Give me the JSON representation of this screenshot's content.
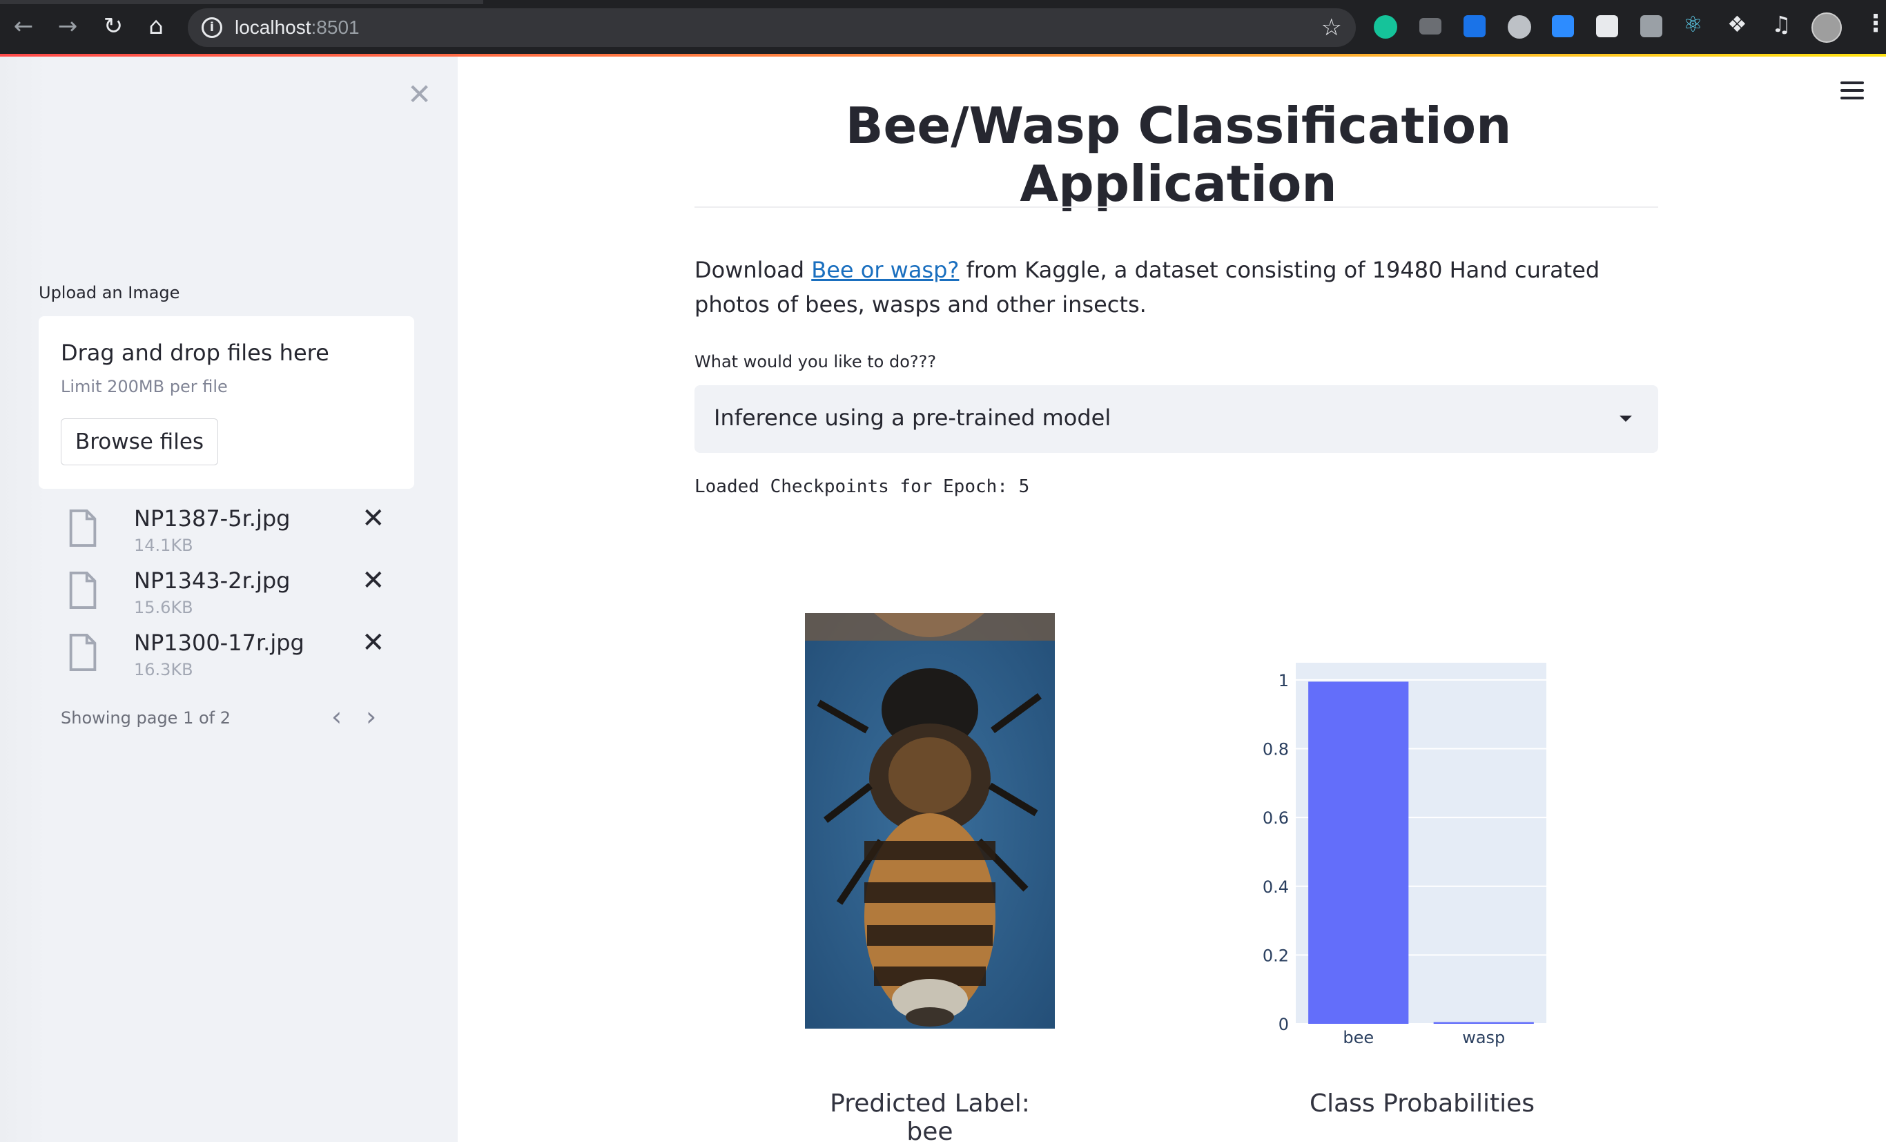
{
  "browser": {
    "url_host": "localhost",
    "url_port": ":8501"
  },
  "sidebar": {
    "upload_label": "Upload an Image",
    "dropzone_title": "Drag and drop files here",
    "dropzone_limit": "Limit 200MB per file",
    "browse_label": "Browse files",
    "files": [
      {
        "name": "NP1387-5r.jpg",
        "size": "14.1KB"
      },
      {
        "name": "NP1343-2r.jpg",
        "size": "15.6KB"
      },
      {
        "name": "NP1300-17r.jpg",
        "size": "16.3KB"
      }
    ],
    "pager_text": "Showing page 1 of 2"
  },
  "main": {
    "title": "Bee/Wasp Classification Application",
    "para_prefix": "Download ",
    "para_link": "Bee or wasp?",
    "para_suffix": " from Kaggle, a dataset consisting of 19480 Hand curated photos of bees, wasps and other insects.",
    "question": "What would you like to do???",
    "select_value": "Inference using a pre-trained model",
    "status": "Loaded Checkpoints for Epoch: 5",
    "predicted_caption": "Predicted Label: bee",
    "chart_caption": "Class Probabilities"
  },
  "colors": {
    "bar": "#636efa",
    "plot_bg": "#e5ecf6",
    "accent": "#ff4b4b",
    "link": "#1a6fbf"
  },
  "chart_data": {
    "type": "bar",
    "categories": [
      "bee",
      "wasp"
    ],
    "values": [
      0.995,
      0.005
    ],
    "ylim": [
      0,
      1.05
    ],
    "yticks": [
      0,
      0.2,
      0.4,
      0.6,
      0.8,
      1
    ],
    "ytick_labels": [
      "0",
      "0.2",
      "0.4",
      "0.6",
      "0.8",
      "1"
    ],
    "grid": true,
    "title": "",
    "xlabel": "",
    "ylabel": ""
  }
}
